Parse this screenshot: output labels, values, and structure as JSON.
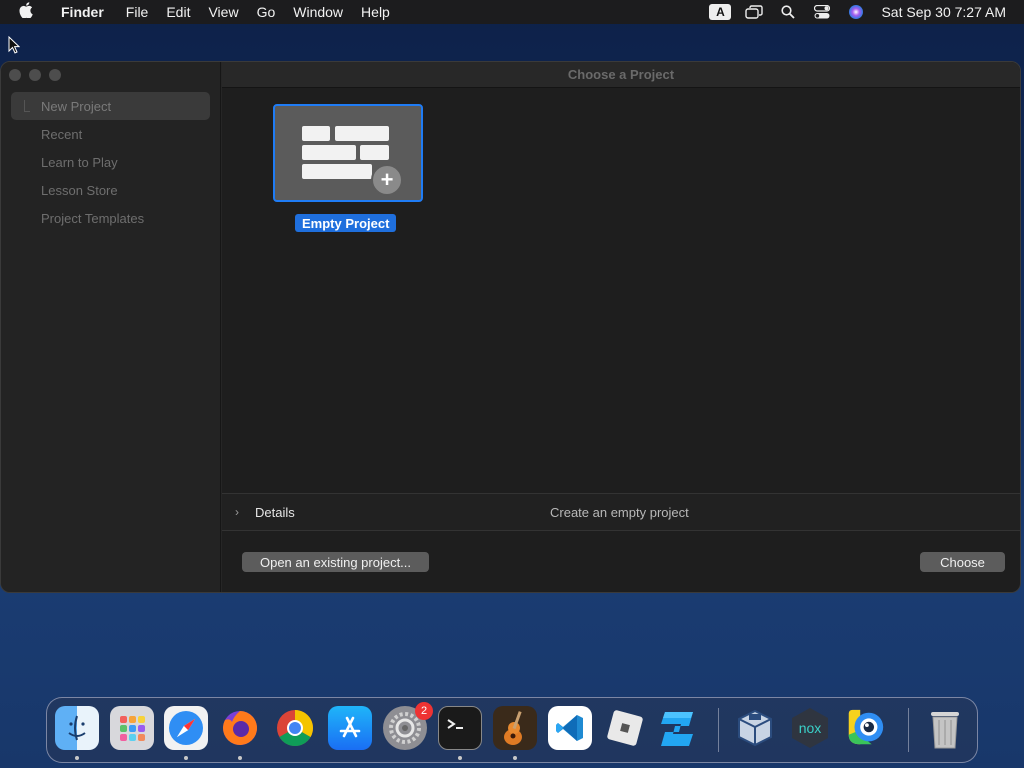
{
  "menubar": {
    "app_name": "Finder",
    "menus": [
      "File",
      "Edit",
      "View",
      "Go",
      "Window",
      "Help"
    ],
    "input_source": "A",
    "clock": "Sat Sep 30  7:27 AM"
  },
  "window": {
    "title": "Choose a Project",
    "sidebar": [
      {
        "label": "New Project",
        "selected": true
      },
      {
        "label": "Recent"
      },
      {
        "label": "Learn to Play"
      },
      {
        "label": "Lesson Store"
      },
      {
        "label": "Project Templates"
      }
    ],
    "tile_label": "Empty Project",
    "details_label": "Details",
    "details_desc": "Create an empty project",
    "open_button": "Open an existing project...",
    "choose_button": "Choose"
  },
  "dock": {
    "settings_badge": "2",
    "apps": [
      "finder-icon",
      "launchpad-icon",
      "safari-icon",
      "firefox-icon",
      "chrome-icon",
      "app-store-icon",
      "system-preferences-icon",
      "terminal-icon",
      "garageband-icon",
      "vscode-icon",
      "roblox-icon",
      "roblox-studio-icon",
      "virtualbox-icon",
      "nox-icon",
      "remote-icon",
      "trash-icon"
    ]
  },
  "colors": {
    "accent": "#1f7cf5",
    "menubar": "#1c1c1e",
    "window_bg": "#1e1e1e",
    "sidebar_bg": "#232323"
  }
}
